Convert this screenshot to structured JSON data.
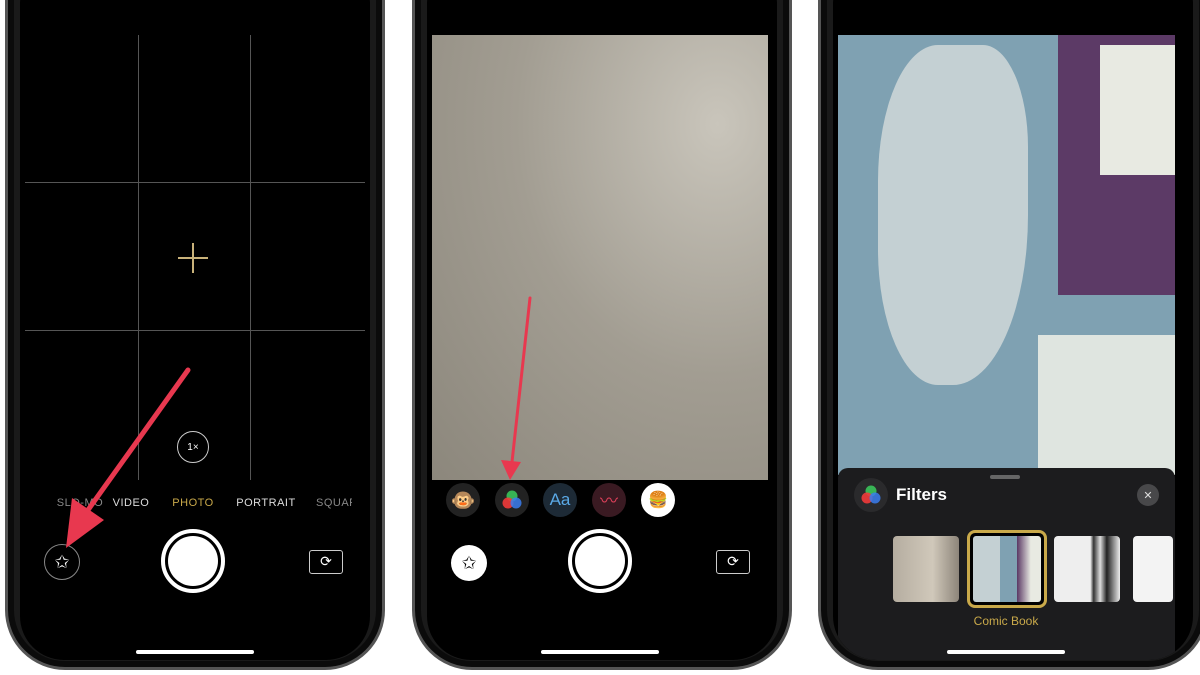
{
  "phone1": {
    "zoom_label": "1×",
    "modes": [
      "SLO-MO",
      "VIDEO",
      "PHOTO",
      "PORTRAIT",
      "SQUARE"
    ],
    "selected_mode": "PHOTO",
    "icons": {
      "live_photo": "live-photo-icon",
      "shutter": "shutter-icon",
      "flip": "flip-camera-icon",
      "crosshair": "focus-crosshair-icon"
    }
  },
  "phone2": {
    "effects": [
      {
        "name": "animoji",
        "glyph": "🐵"
      },
      {
        "name": "filters",
        "glyph": ""
      },
      {
        "name": "text",
        "glyph": "Aa"
      },
      {
        "name": "shapes",
        "glyph": "〰"
      },
      {
        "name": "stickers",
        "glyph": "🍔"
      }
    ]
  },
  "phone3": {
    "panel_title": "Filters",
    "selected_filter": "Comic Book",
    "close_glyph": "✕"
  },
  "colors": {
    "accent_gold": "#c9a94a",
    "arrow_red": "#e8384f",
    "panel_bg": "#1c1c1e"
  }
}
